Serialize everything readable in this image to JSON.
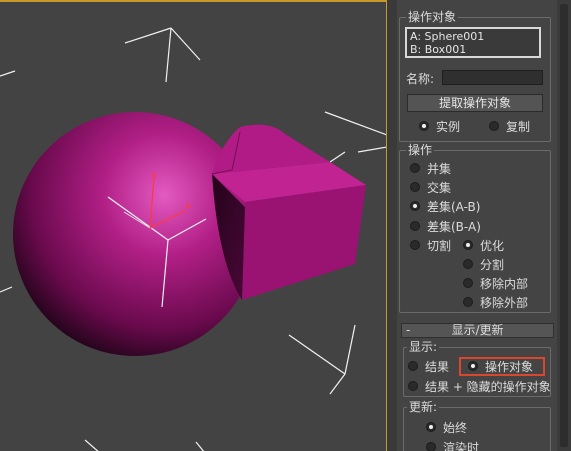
{
  "panel": {
    "operands": {
      "title": "操作对象",
      "items": [
        "A: Sphere001",
        "B: Box001"
      ],
      "name_label": "名称:",
      "name_value": "",
      "extract_button": "提取操作对象",
      "copy_modes": [
        {
          "label": "实例",
          "selected": true
        },
        {
          "label": "复制",
          "selected": false
        }
      ]
    },
    "operation": {
      "title": "操作",
      "options": [
        {
          "label": "并集",
          "selected": false
        },
        {
          "label": "交集",
          "selected": false
        },
        {
          "label": "差集(A-B)",
          "selected": true
        },
        {
          "label": "差集(B-A)",
          "selected": false
        },
        {
          "label": "切割",
          "selected": false
        }
      ],
      "cut_options": [
        {
          "label": "优化",
          "selected": true
        },
        {
          "label": "分割",
          "selected": false
        },
        {
          "label": "移除内部",
          "selected": false
        },
        {
          "label": "移除外部",
          "selected": false
        }
      ]
    },
    "display_update": {
      "collapse_symbol": "-",
      "title": "显示/更新",
      "display_title": "显示:",
      "display_options": [
        {
          "label": "结果",
          "selected": false
        },
        {
          "label": "操作对象",
          "selected": true
        },
        {
          "label": "结果 + 隐藏的操作对象",
          "selected": false
        }
      ],
      "update_title": "更新:",
      "update_options": [
        {
          "label": "始终",
          "selected": true
        },
        {
          "label": "渲染时",
          "selected": false
        }
      ]
    }
  },
  "colors": {
    "accent_border": "#c89a2a",
    "highlight": "#d9472f",
    "object": "#a0146f"
  }
}
